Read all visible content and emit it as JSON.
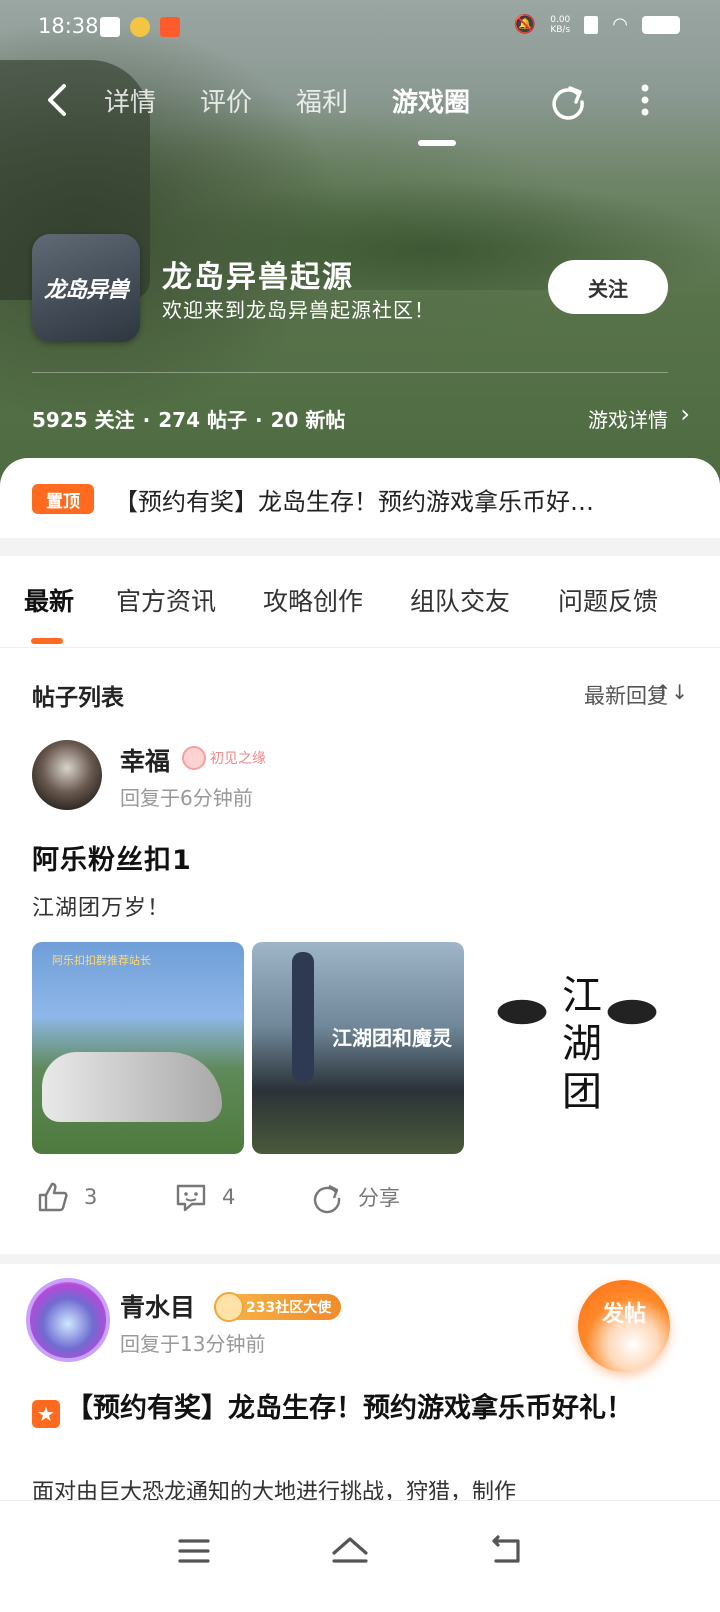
{
  "status_bar": {
    "time": "18:38",
    "net_speed": "0.00\nKB/s"
  },
  "nav": {
    "tabs": [
      "详情",
      "评价",
      "福利",
      "游戏圈"
    ],
    "active_tab": "游戏圈"
  },
  "game": {
    "logo_text": "龙岛异兽",
    "title": "龙岛异兽起源",
    "subtitle": "欢迎来到龙岛异兽起源社区！",
    "follow_label": "关注",
    "stats": {
      "followers": "5925 关注",
      "posts": "274 帖子",
      "new_posts": "20 新帖"
    },
    "detail_link": "游戏详情"
  },
  "pinned": {
    "badge": "置顶",
    "text": "【预约有奖】龙岛生存！预约游戏拿乐币好…"
  },
  "category_tabs": [
    "最新",
    "官方资讯",
    "攻略创作",
    "组队交友",
    "问题反馈"
  ],
  "list": {
    "header": "帖子列表",
    "sort_label": "最新回复",
    "sort_icon": "↑↓"
  },
  "post1": {
    "username": "幸福",
    "badge": "初见之缘",
    "time": "回复于6分钟前",
    "title": "阿乐粉丝扣1",
    "body": "江湖团万岁！",
    "image1_caption": "阿乐扣扣群推荐站长",
    "image2_caption": "江湖团和魔灵",
    "image3_text": "江湖团",
    "likes": "3",
    "comments": "4",
    "share": "分享"
  },
  "post2": {
    "username": "青水目",
    "badge": "233社区大使",
    "time": "回复于13分钟前",
    "title": "【预约有奖】龙岛生存！预约游戏拿乐币好礼！",
    "body": "面对由巨大恐龙通知的大地进行挑战，狩猎，制作"
  },
  "fab_label": "发帖",
  "colors": {
    "accent": "#ff6a1f",
    "hero_green": "#58734a"
  }
}
